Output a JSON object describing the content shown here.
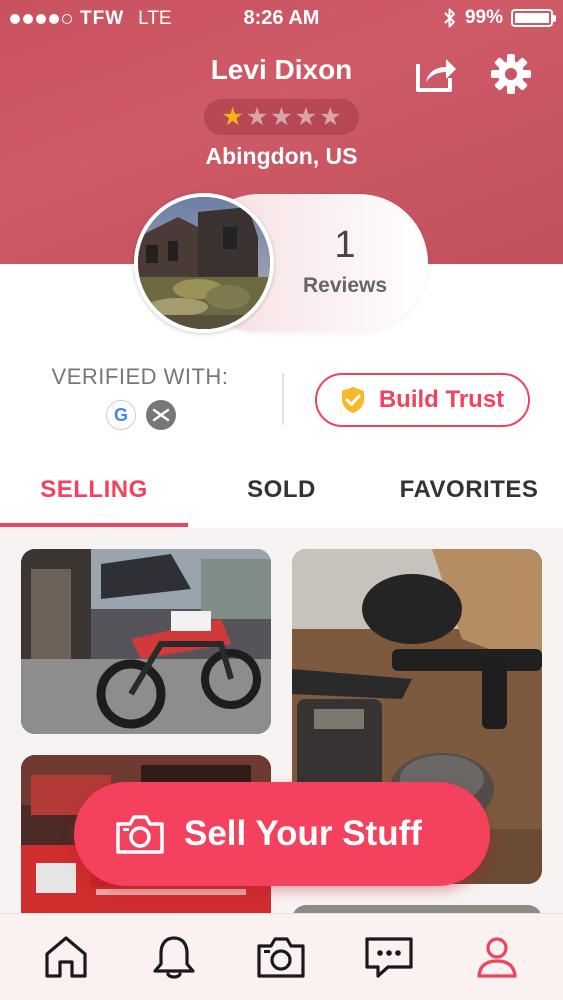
{
  "status_bar": {
    "carrier": "TFW",
    "network": "LTE",
    "time": "8:26 AM",
    "battery": "99%",
    "battery_level": 0.99,
    "signal_bars": 4
  },
  "profile": {
    "name": "Levi Dixon",
    "rating": 1,
    "rating_max": 5,
    "location": "Abingdon, US",
    "reviews_count": "1",
    "reviews_label": "Reviews"
  },
  "verification": {
    "label": "VERIFIED WITH:",
    "methods": [
      "google-icon",
      "email-icon"
    ]
  },
  "build_trust": {
    "label": "Build Trust"
  },
  "tabs": {
    "selling": "SELLING",
    "sold": "SOLD",
    "favorites": "FAVORITES",
    "active": "selling"
  },
  "listings": [
    {
      "image": "dirt-bike-photo"
    },
    {
      "image": "paintball-gun-photo"
    },
    {
      "image": "fuel-box-photo"
    },
    {
      "image": "gravel-photo"
    }
  ],
  "sell_button": {
    "label": "Sell Your Stuff"
  },
  "bottom_nav": {
    "items": [
      "home-icon",
      "bell-icon",
      "camera-icon",
      "chat-icon",
      "profile-icon"
    ],
    "active": "profile-icon"
  },
  "colors": {
    "accent": "#f0435e",
    "header": "#c9525f",
    "star_filled": "#f5b31b"
  }
}
